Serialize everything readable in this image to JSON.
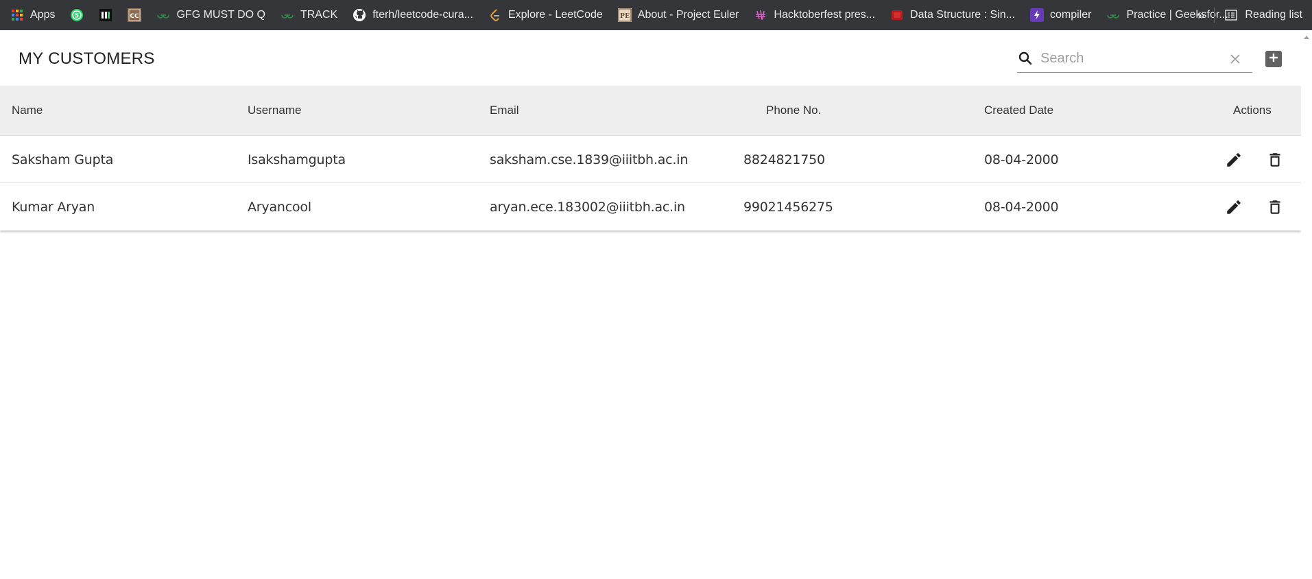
{
  "bookmarks": [
    {
      "label": "Apps",
      "icon": "apps-grid-icon"
    },
    {
      "label": "",
      "icon": "whatsapp-icon"
    },
    {
      "label": "",
      "icon": "hackerearth-icon"
    },
    {
      "label": "",
      "icon": "codechef-icon"
    },
    {
      "label": "GFG MUST DO Q",
      "icon": "gfg-icon"
    },
    {
      "label": "TRACK",
      "icon": "gfg-icon"
    },
    {
      "label": "fterh/leetcode-cura...",
      "icon": "github-icon"
    },
    {
      "label": "Explore - LeetCode",
      "icon": "leetcode-icon"
    },
    {
      "label": "About - Project Euler",
      "icon": "project-euler-icon"
    },
    {
      "label": "Hacktoberfest pres...",
      "icon": "hacktoberfest-icon"
    },
    {
      "label": "Data Structure : Sin...",
      "icon": "bookmark-red-icon"
    },
    {
      "label": "compiler",
      "icon": "lightning-icon"
    },
    {
      "label": "Practice | Geeksfor...",
      "icon": "gfg-icon"
    }
  ],
  "bookmarks_more": "»",
  "reading_list": "Reading list",
  "header": {
    "title": "MY CUSTOMERS",
    "search_placeholder": "Search",
    "search_value": ""
  },
  "table": {
    "columns": {
      "name": "Name",
      "username": "Username",
      "email": "Email",
      "phone": "Phone No.",
      "created": "Created Date",
      "actions": "Actions"
    },
    "rows": [
      {
        "name": "Saksham Gupta",
        "username": "Isakshamgupta",
        "email": "saksham.cse.1839@iiitbh.ac.in",
        "phone": "8824821750",
        "created": "08-04-2000"
      },
      {
        "name": "Kumar Aryan",
        "username": "Aryancool",
        "email": "aryan.ece.183002@iiitbh.ac.in",
        "phone": "99021456275",
        "created": "08-04-2000"
      }
    ]
  },
  "colors": {
    "bookmarks_bg": "#35363a",
    "header_row_bg": "#eeeeee",
    "gfg_green": "#2f8d46",
    "icon_dark": "#212121"
  }
}
